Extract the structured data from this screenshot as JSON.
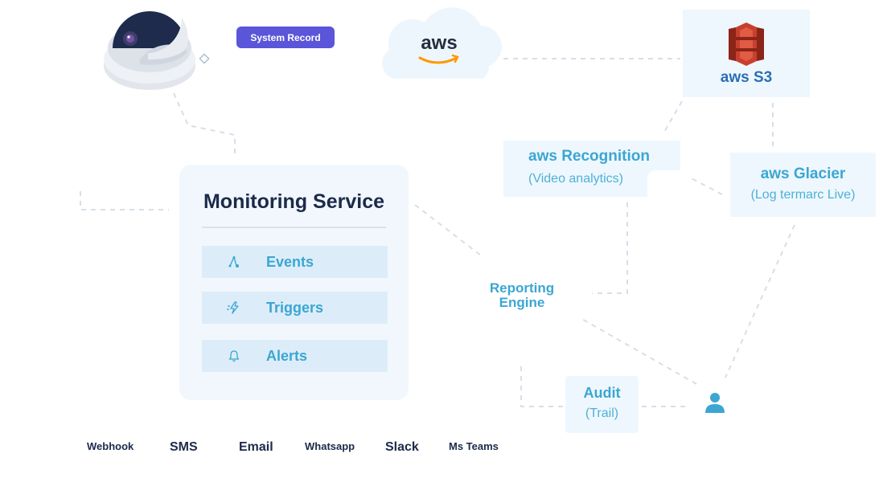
{
  "camera": {
    "record_label": "System Record"
  },
  "cloud": {
    "logo_text": "aws"
  },
  "s3": {
    "label": "aws S3"
  },
  "recognition": {
    "title": "aws Recognition",
    "subtitle": "(Video analytics)"
  },
  "glacier": {
    "title": "aws Glacier",
    "subtitle": "(Log termarc Live)"
  },
  "monitoring": {
    "title": "Monitoring Service",
    "items": [
      {
        "label": "Events",
        "icon": "events-icon"
      },
      {
        "label": "Triggers",
        "icon": "triggers-icon"
      },
      {
        "label": "Alerts",
        "icon": "bell-icon"
      }
    ]
  },
  "reporting": {
    "line1": "Reporting",
    "line2": "Engine"
  },
  "audit": {
    "title": "Audit",
    "subtitle": "(Trail)"
  },
  "user": {
    "icon": "user-icon"
  },
  "channels": [
    "Webhook",
    "SMS",
    "Email",
    "Whatsapp",
    "Slack",
    "Ms Teams"
  ],
  "colors": {
    "accent_purple": "#5a55d9",
    "accent_blue": "#3ba6d2",
    "dark_text": "#1c2a4a",
    "aws_orange": "#ff9900",
    "s3_red": "#c7402e"
  }
}
